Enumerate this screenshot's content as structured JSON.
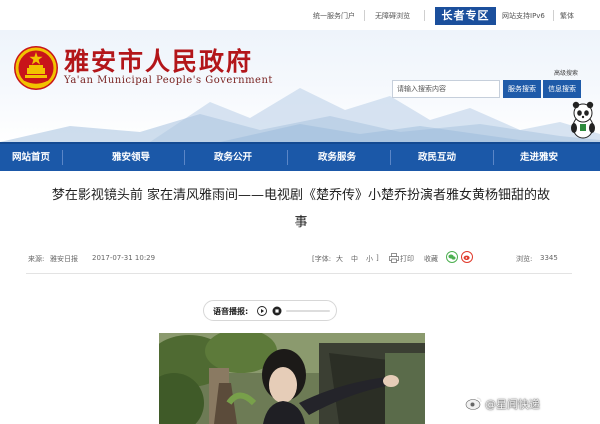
{
  "topbar": {
    "links": [
      "统一服务门户",
      "无障碍浏览",
      "网站支持IPv6",
      "繁体"
    ],
    "elder_zone": "长者专区"
  },
  "header": {
    "site_name_cn": "雅安市人民政府",
    "site_name_en": "Ya'an Municipal People's Government",
    "advanced_search": "高级搜索",
    "search_placeholder": "请输入搜索内容",
    "search_service": "服务搜索",
    "search_info": "信息搜索"
  },
  "nav": {
    "items": [
      "网站首页",
      "雅安领导",
      "政务公开",
      "政务服务",
      "政民互动",
      "走进雅安"
    ]
  },
  "article": {
    "title_line1": "梦在影视镜头前 家在清风雅雨间——电视剧《楚乔传》小楚乔扮演者雅女黄杨钿甜的故",
    "title_line2": "事",
    "source_label": "来源:",
    "source": "雅安日报",
    "date": "2017-07-31 10:29",
    "font_label": "[字体:",
    "font_large": "大",
    "font_medium": "中",
    "font_small": "小",
    "font_close": "]",
    "print": "打印",
    "favorite": "收藏",
    "views_label": "浏览:",
    "views": "3345"
  },
  "voice_player": {
    "label": "语音播报:"
  },
  "watermark": {
    "text": "@星闻快递"
  },
  "colors": {
    "nav_bg": "#1b58a8",
    "elder_bg": "#1b4f9c",
    "brand_red": "#b3161a",
    "search_button": "#1f5ba9"
  },
  "icons": [
    "national-emblem-icon",
    "panda-mascot-icon",
    "print-icon",
    "favorite-icon",
    "wechat-icon",
    "weibo-icon",
    "play-icon",
    "stop-icon",
    "weibo-logo-icon"
  ]
}
